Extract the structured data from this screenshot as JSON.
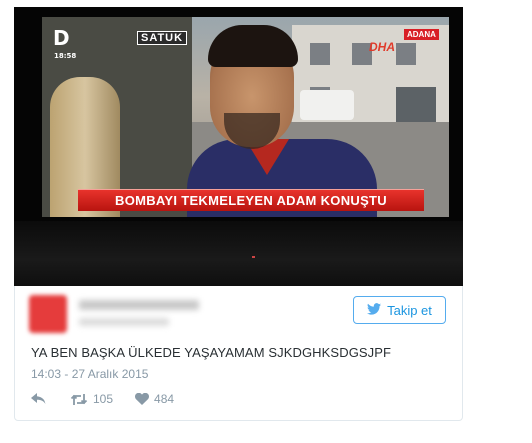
{
  "photo": {
    "channel_logo": "D",
    "clock": "18:58",
    "shop_sign": "SATUK",
    "agency": "DHA",
    "city": "ADANA",
    "headline": "BOMBAYI TEKMELEYEN ADAM KONUŞTU"
  },
  "follow_button": {
    "label": "Takip et",
    "icon": "twitter-bird-icon"
  },
  "tweet": {
    "text": "YA BEN BAŞKA ÜLKEDE YAŞAYAMAM SJKDGHKSDGSJPF",
    "timestamp": "14:03 - 27 Aralık 2015"
  },
  "actions": {
    "reply_icon": "reply-icon",
    "retweet_icon": "retweet-icon",
    "retweets": "105",
    "like_icon": "heart-icon",
    "likes": "484"
  },
  "colors": {
    "twitter_blue": "#55acee",
    "ticker_red": "#d81f26",
    "meta_gray": "#8899a6"
  }
}
